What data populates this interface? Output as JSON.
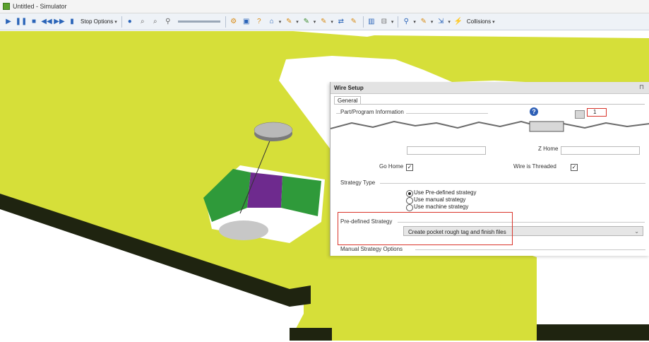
{
  "window": {
    "title": "Untitled - Simulator"
  },
  "toolbar": {
    "stop_options_label": "Stop Options",
    "collisions_label": "Collisions"
  },
  "dialog": {
    "title": "Wire Setup",
    "tab_general": "General",
    "part_program_info_label": "Part/Program Information",
    "field_value": "1",
    "z_home_label": "Z Home",
    "go_home_label": "Go Home",
    "go_home_checked": true,
    "wire_threaded_label": "Wire is Threaded",
    "wire_threaded_checked": true,
    "strategy_type_label": "Strategy Type",
    "strategy_options": [
      "Use Pre-defined strategy",
      "Use manual strategy",
      "Use machine strategy"
    ],
    "strategy_selected_index": 0,
    "predefined_strategy_label": "Pre-defined Strategy",
    "predefined_strategy_value": "Create pocket rough tag and finish files",
    "manual_strategy_options_label": "Manual Strategy Options"
  },
  "colors": {
    "part_surface": "#d6df39",
    "part_side": "#1f2410",
    "wire_spool": "#b9b9b9",
    "pocket_green": "#2f9a3a",
    "pocket_purple": "#6e2a8e",
    "highlight_red": "#d9342b"
  }
}
